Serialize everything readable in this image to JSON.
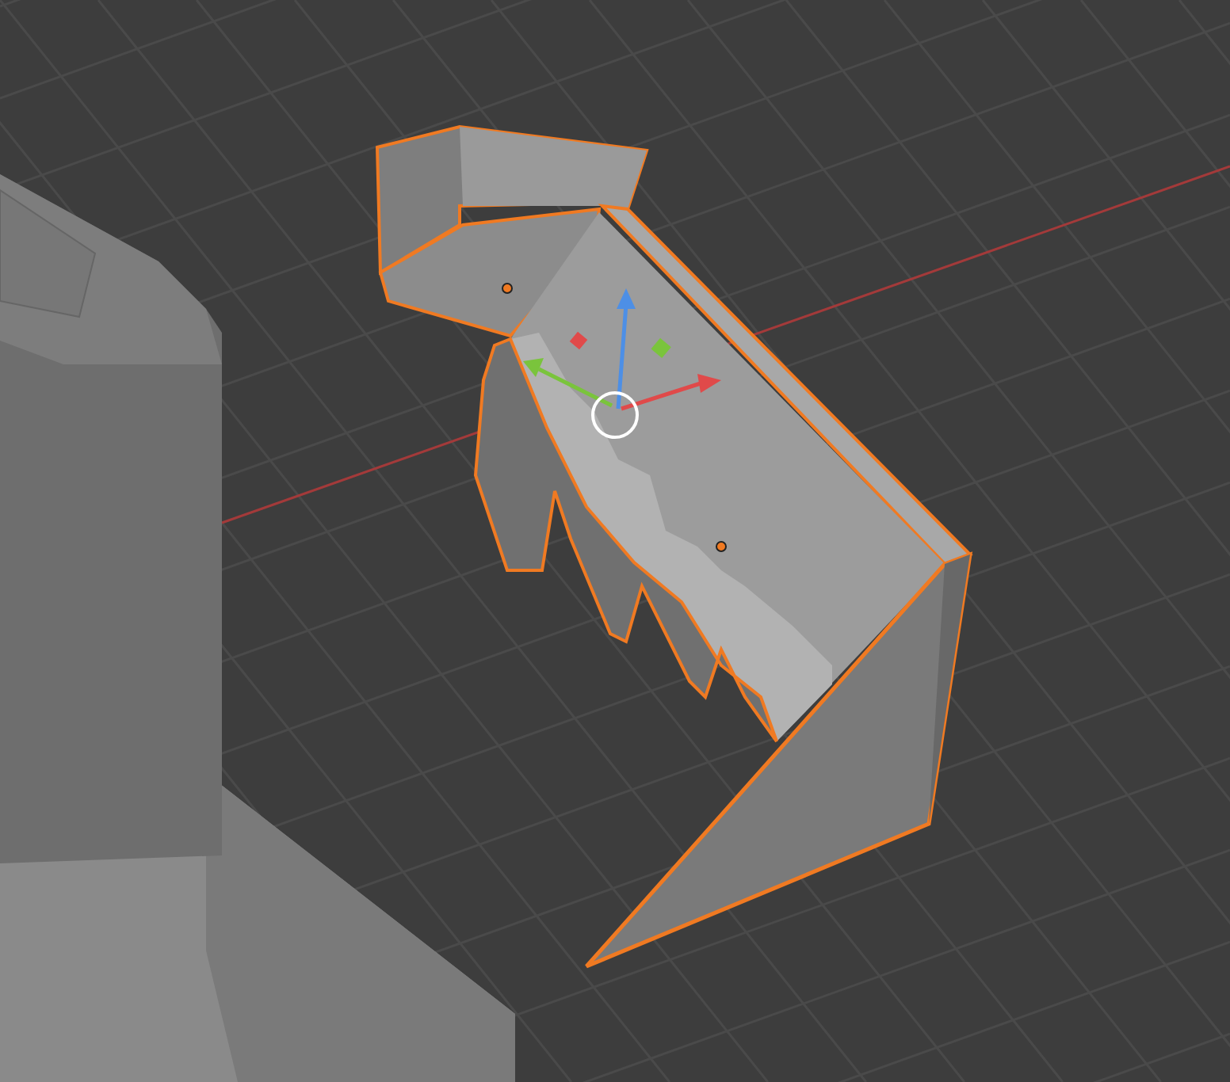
{
  "scene": {
    "objects": [
      {
        "kind": "stairs",
        "selected": true
      },
      {
        "kind": "block",
        "selected": false
      }
    ],
    "gizmo": {
      "kind": "move"
    }
  }
}
